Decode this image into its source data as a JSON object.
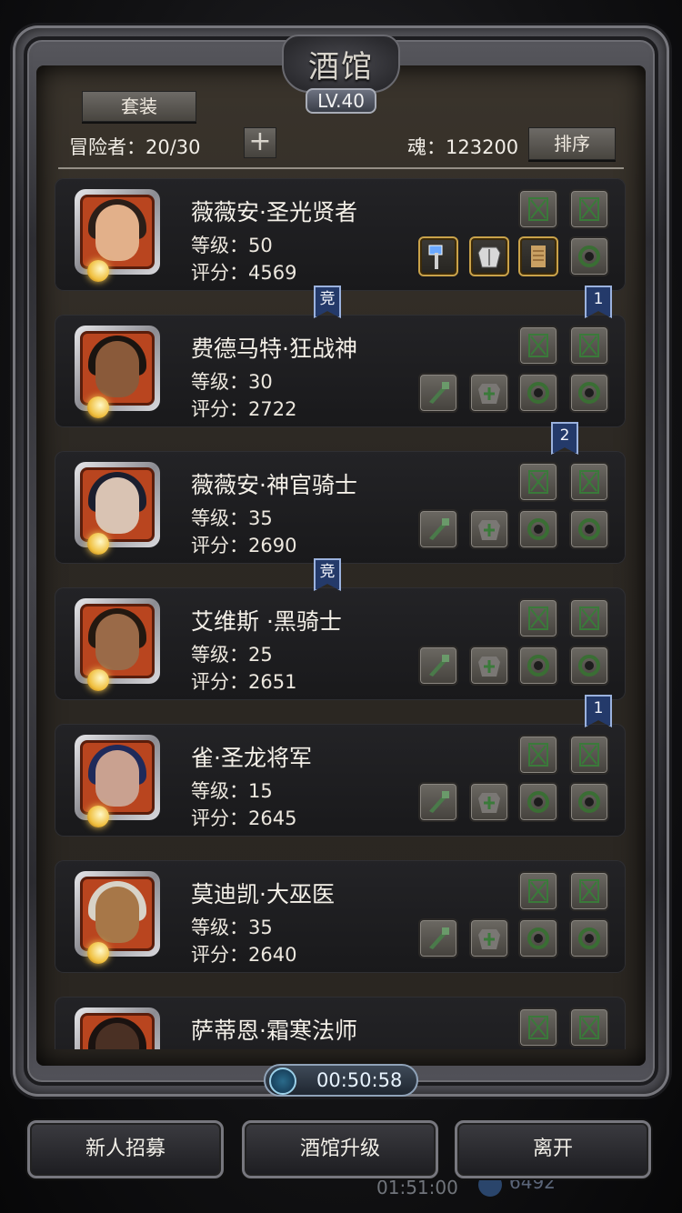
{
  "window": {
    "title": "酒馆",
    "level_badge": "LV.40"
  },
  "header": {
    "set_button": "套装",
    "adventurers_label": "冒险者：20/30",
    "plus_symbol": "+",
    "soul_label": "魂：123200",
    "sort_button": "排序"
  },
  "heroes": [
    {
      "name": "薇薇安·圣光贤者",
      "level": "等级：50",
      "score": "评分：4569",
      "equipped": [
        "hammer",
        "armor",
        "scroll"
      ],
      "skin": "#e2b08a",
      "hair": "#2b1e18"
    },
    {
      "name": "费德马特·狂战神",
      "level": "等级：30",
      "score": "评分：2722",
      "equipped": [],
      "skin": "#8a5a3a",
      "hair": "#1a1410"
    },
    {
      "name": "薇薇安·神官骑士",
      "level": "等级：35",
      "score": "评分：2690",
      "equipped": [],
      "skin": "#d9c3b3",
      "hair": "#1b1e2e"
    },
    {
      "name": "艾维斯 ·黑骑士",
      "level": "等级：25",
      "score": "评分：2651",
      "equipped": [],
      "skin": "#9a6a48",
      "hair": "#231810"
    },
    {
      "name": "雀·圣龙将军",
      "level": "等级：15",
      "score": "评分：2645",
      "equipped": [],
      "skin": "#c9a190",
      "hair": "#1f2a5a"
    },
    {
      "name": "莫迪凯·大巫医",
      "level": "等级：35",
      "score": "评分：2640",
      "equipped": [],
      "skin": "#a77748",
      "hair": "#d8d3c8"
    },
    {
      "name": "萨蒂恩·霜寒法师",
      "level": "",
      "score": "",
      "equipped": [],
      "skin": "#4a3024",
      "hair": "#1a1210"
    }
  ],
  "tags": [
    "竞",
    "1",
    "2",
    "竞",
    "1"
  ],
  "timer": {
    "value": "00:50:58"
  },
  "footer": {
    "recruit": "新人招募",
    "upgrade": "酒馆升级",
    "leave": "离开"
  },
  "background": {
    "time": "01:51:00",
    "number": "6492"
  },
  "colors": {
    "panel": "#2c2823",
    "card": "#1d1d20",
    "portrait_border": "#b9451f",
    "tag": "#243a6a"
  }
}
